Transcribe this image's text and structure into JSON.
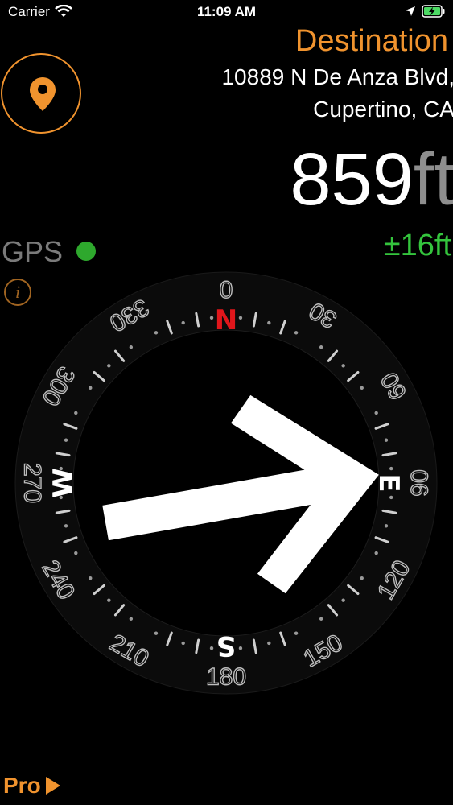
{
  "status_bar": {
    "carrier": "Carrier",
    "time": "11:09 AM",
    "icons": [
      "wifi-icon",
      "location-arrow-icon",
      "battery-charging-icon"
    ]
  },
  "destination": {
    "title": "Destination",
    "address_line1": "10889 N De Anza Blvd,",
    "address_line2": "Cupertino, CA"
  },
  "distance": {
    "value": "859",
    "unit": "ft",
    "accuracy": "±16ft"
  },
  "gps": {
    "label": "GPS",
    "status_color": "#2ea82d"
  },
  "info_icon_label": "i",
  "compass": {
    "cardinals": [
      {
        "label": "N",
        "angle": 0,
        "color": "#e0161b"
      },
      {
        "label": "E",
        "angle": 90,
        "color": "#ffffff"
      },
      {
        "label": "S",
        "angle": 180,
        "color": "#ffffff"
      },
      {
        "label": "W",
        "angle": 270,
        "color": "#ffffff"
      }
    ],
    "degree_labels": [
      "0",
      "30",
      "60",
      "90",
      "120",
      "150",
      "180",
      "210",
      "240",
      "270",
      "300",
      "330"
    ],
    "rotation_deg": 0,
    "arrow_bearing_deg": 80
  },
  "pro": {
    "label": "Pro"
  },
  "colors": {
    "accent": "#f0932e",
    "accuracy": "#34c43d",
    "north": "#e0161b",
    "background": "#000000"
  }
}
